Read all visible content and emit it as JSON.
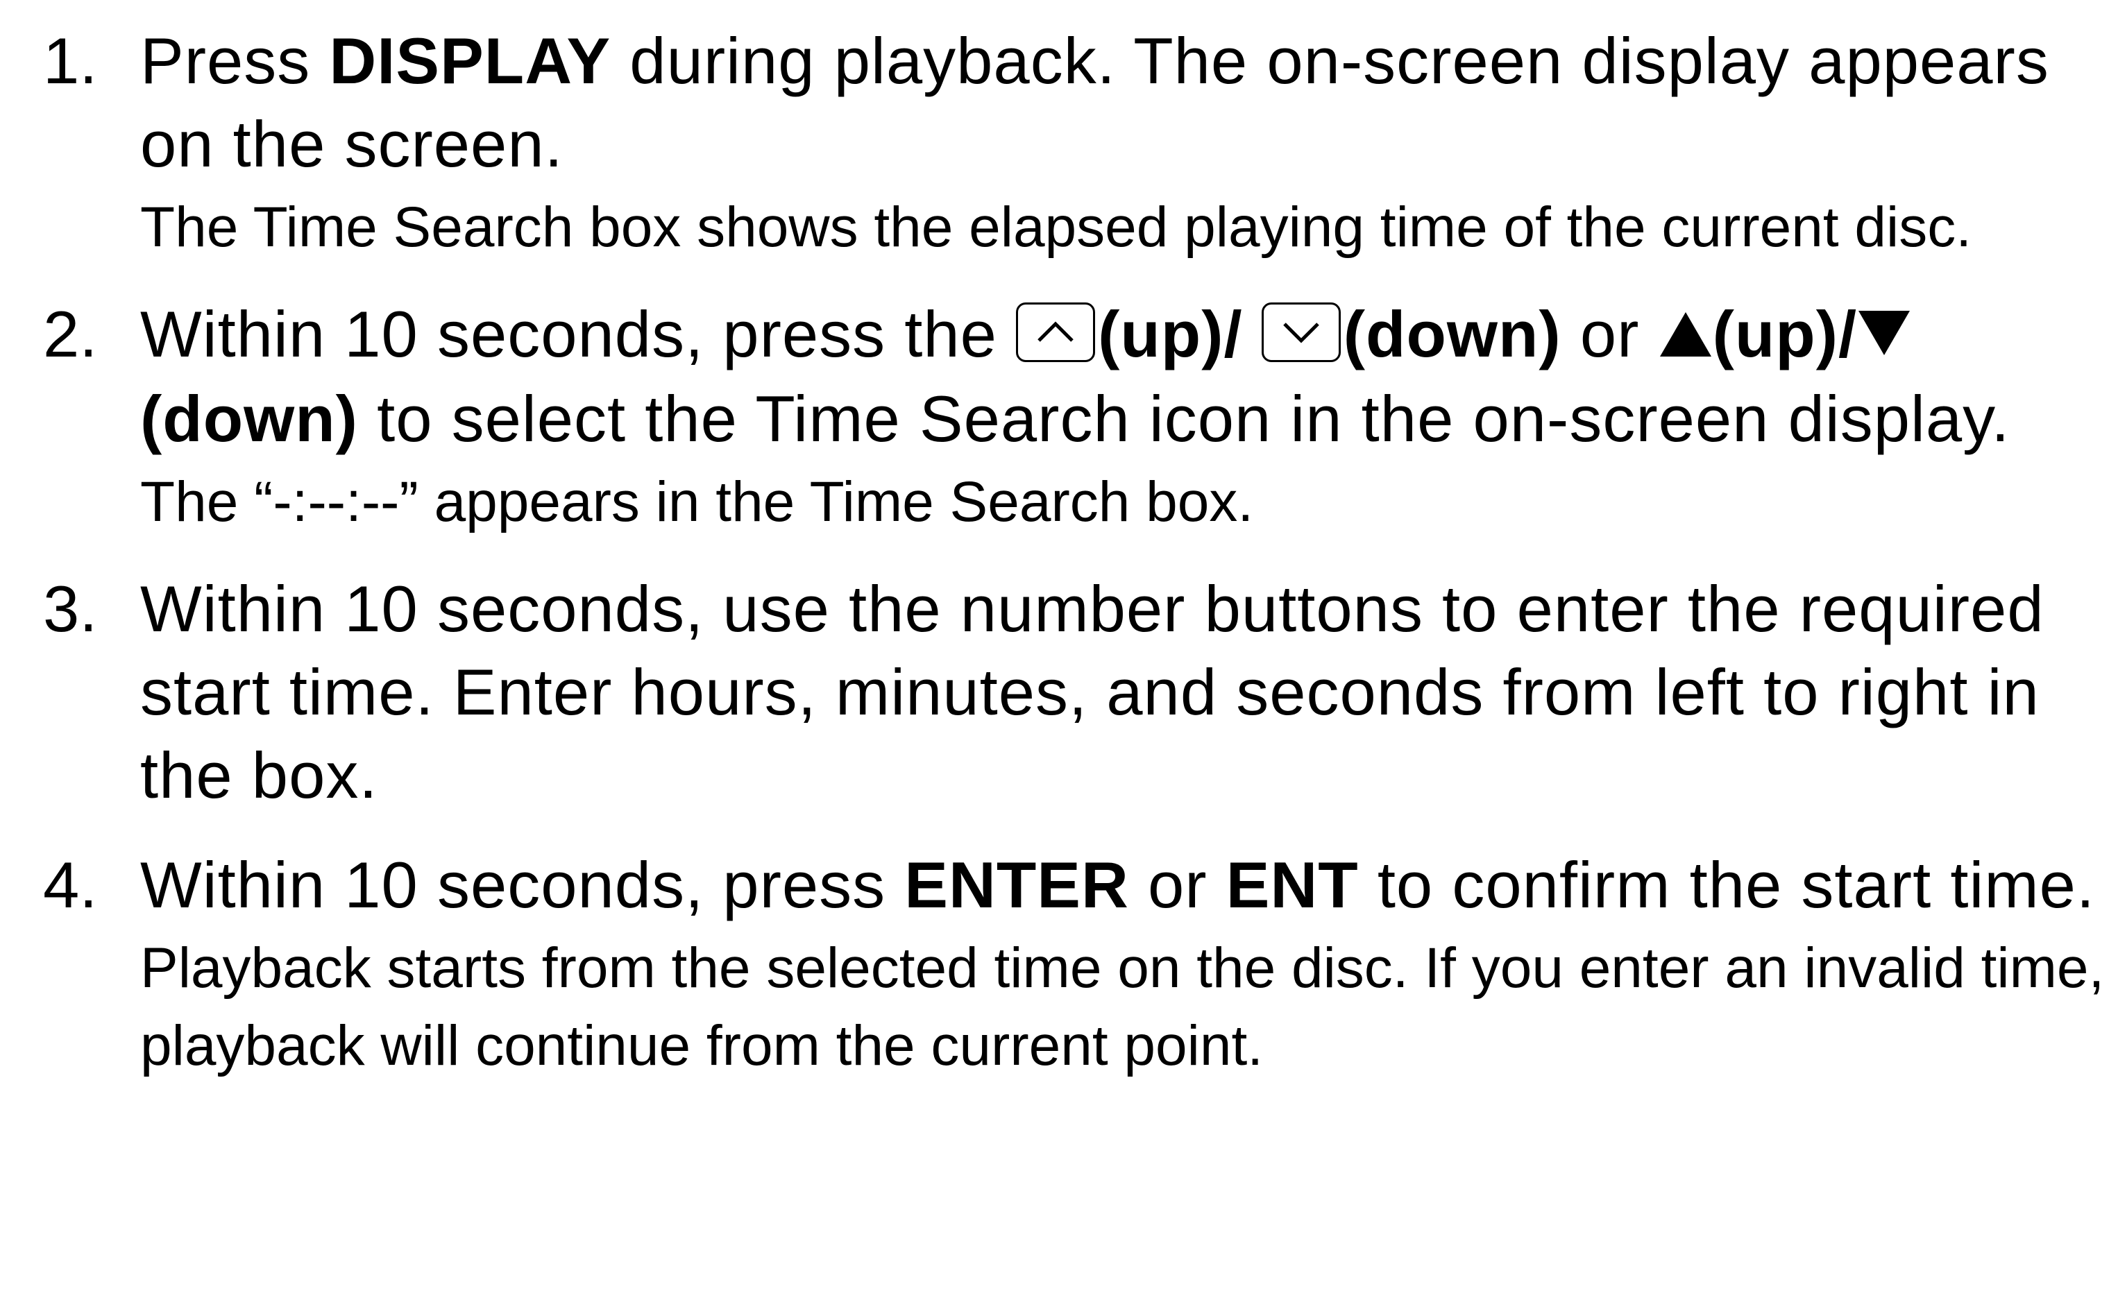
{
  "steps": [
    {
      "number": "1.",
      "main": [
        {
          "t": "Press "
        },
        {
          "t": "DISPLAY",
          "b": true
        },
        {
          "t": " during playback. The on-screen display appears on the screen."
        }
      ],
      "note": "The Time Search box shows the elapsed playing time of the current disc."
    },
    {
      "number": "2.",
      "main": [
        {
          "t": "Within 10 seconds, press the "
        },
        {
          "icon": "up-key-icon"
        },
        {
          "t": "(up)/ ",
          "b": true
        },
        {
          "icon": "down-key-icon"
        },
        {
          "t": "(down)",
          "b": true
        },
        {
          "t": " or "
        },
        {
          "icon": "up-triangle-icon"
        },
        {
          "t": "(up)/",
          "b": true
        },
        {
          "icon": "down-triangle-icon"
        },
        {
          "t": "(down)",
          "b": true
        },
        {
          "t": " to select the Time Search icon in the on-screen display."
        }
      ],
      "note": "The “-:--:--” appears in the Time Search box."
    },
    {
      "number": "3.",
      "main": [
        {
          "t": "Within 10 seconds, use the number buttons to enter the required start time. Enter hours, minutes, and seconds from left to right in the box."
        }
      ],
      "note": ""
    },
    {
      "number": "4.",
      "main": [
        {
          "t": "Within 10 seconds, press "
        },
        {
          "t": "ENTER",
          "b": true
        },
        {
          "t": " or "
        },
        {
          "t": "ENT",
          "b": true
        },
        {
          "t": " to confirm the start time."
        }
      ],
      "note": "Playback starts from the selected time on the disc. If you enter an invalid time, playback will continue from the current point."
    }
  ]
}
